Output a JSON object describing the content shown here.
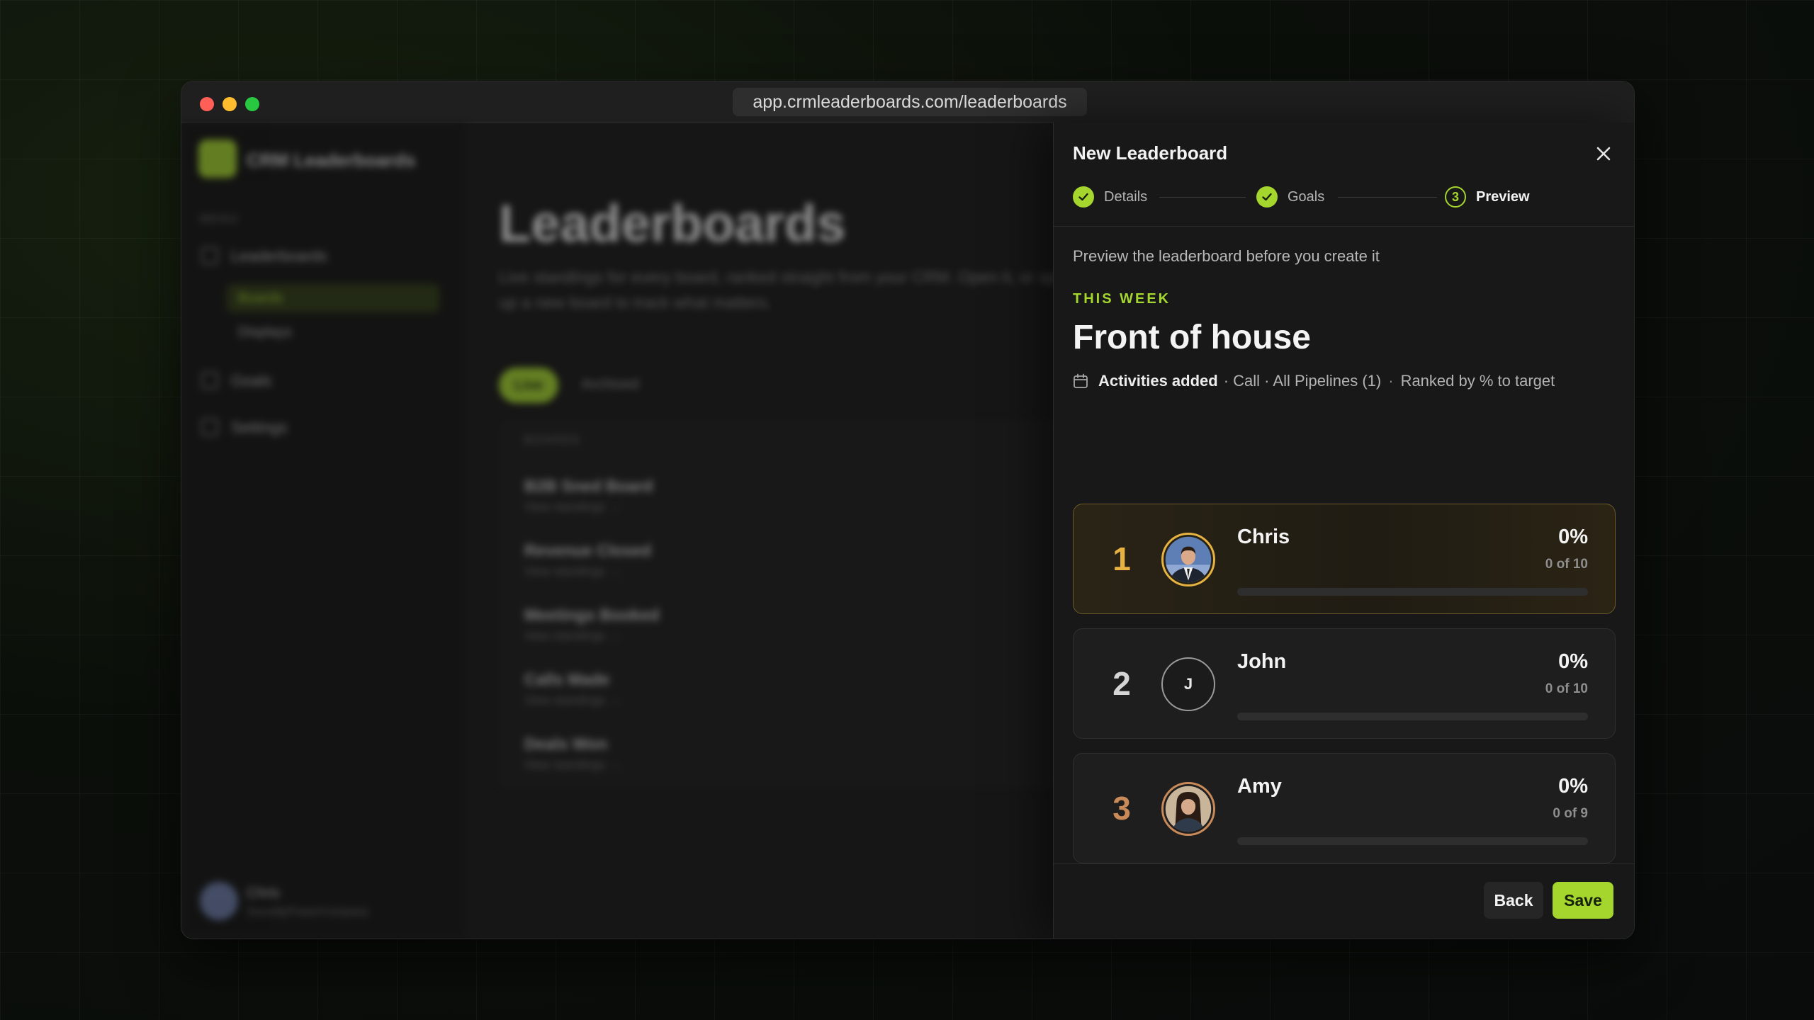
{
  "browser": {
    "url": "app.crmleaderboards.com/leaderboards"
  },
  "background_app": {
    "brand": "CRM Leaderboards",
    "menu_caption": "MENU",
    "nav": [
      {
        "label": "Leaderboards",
        "icon": "trophy-icon"
      },
      {
        "label": "Goals",
        "icon": "target-icon"
      },
      {
        "label": "Settings",
        "icon": "gear-icon"
      }
    ],
    "subnav": [
      "Boards",
      "Displays"
    ],
    "page_title": "Leaderboards",
    "page_desc": "Live standings for every board, ranked straight from your CRM. Open it, or spin up a new board to track what matters.",
    "tabs": [
      "Live",
      "Archived"
    ],
    "table_header": "BOARDS",
    "boards": [
      {
        "name": "B2B Sned Board",
        "link": "View standings →"
      },
      {
        "name": "Revenue Closed",
        "link": "View standings →"
      },
      {
        "name": "Meetings Booked",
        "link": "View standings →"
      },
      {
        "name": "Calls Made",
        "link": "View standings →"
      },
      {
        "name": "Deals Won",
        "link": "View standings →"
      }
    ],
    "user": {
      "name": "Chris",
      "company": "SoundlyPowerCompany"
    }
  },
  "panel": {
    "title": "New Leaderboard",
    "close_icon": "close-icon",
    "steps": [
      {
        "label": "Details",
        "state": "done"
      },
      {
        "label": "Goals",
        "state": "done"
      },
      {
        "label": "Preview",
        "state": "current",
        "number": "3"
      }
    ],
    "preview_desc": "Preview the leaderboard before you create it",
    "eyebrow": "THIS WEEK",
    "board_title": "Front of house",
    "meta": {
      "icon": "calendar-icon",
      "metric": "Activities added",
      "filters": "· Call · All Pipelines (1)",
      "ranking": "Ranked by % to target"
    },
    "entries": [
      {
        "rank": "1",
        "name": "Chris",
        "pct": "0%",
        "count": "0 of 10",
        "progress": 0,
        "avatar": "photo",
        "rank_color": "#e6b342",
        "ring_color": "#e6b342"
      },
      {
        "rank": "2",
        "name": "John",
        "pct": "0%",
        "count": "0 of 10",
        "progress": 0,
        "avatar": "initial",
        "initial": "J",
        "rank_color": "#d5d5d5",
        "ring_color": "#9a9a9a"
      },
      {
        "rank": "3",
        "name": "Amy",
        "pct": "0%",
        "count": "0 of 9",
        "progress": 0,
        "avatar": "photo",
        "rank_color": "#c98a5a",
        "ring_color": "#c98a5a"
      }
    ],
    "buttons": {
      "back": "Back",
      "save": "Save"
    },
    "colors": {
      "accent": "#a4d62e",
      "gold": "#e6b342",
      "silver": "#d5d5d5",
      "bronze": "#c98a5a"
    }
  }
}
